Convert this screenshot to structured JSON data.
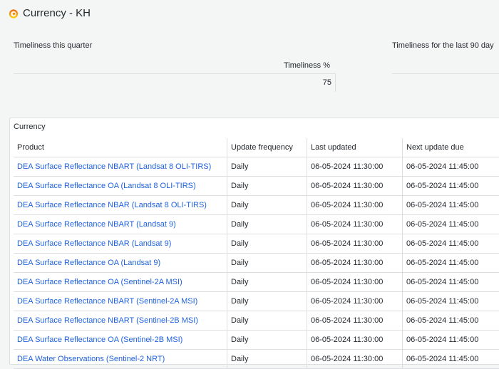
{
  "header": {
    "title": "Currency - KH",
    "logo_icon": "grafana-logo-icon"
  },
  "panel_quarter": {
    "title": "Timeliness this quarter",
    "column_header": "Timeliness %",
    "value": "75"
  },
  "panel_90days": {
    "title": "Timeliness for the last 90 day"
  },
  "currency": {
    "title": "Currency",
    "columns": [
      "Product",
      "Update frequency",
      "Last updated",
      "Next update due"
    ],
    "rows": [
      {
        "product": "DEA Surface Reflectance NBART (Landsat 8 OLI-TIRS)",
        "frequency": "Daily",
        "last": "06-05-2024 11:30:00",
        "next": "06-05-2024 11:45:00"
      },
      {
        "product": "DEA Surface Reflectance OA (Landsat 8 OLI-TIRS)",
        "frequency": "Daily",
        "last": "06-05-2024 11:30:00",
        "next": "06-05-2024 11:45:00"
      },
      {
        "product": "DEA Surface Reflectance NBAR (Landsat 8 OLI-TIRS)",
        "frequency": "Daily",
        "last": "06-05-2024 11:30:00",
        "next": "06-05-2024 11:45:00"
      },
      {
        "product": "DEA Surface Reflectance NBART (Landsat 9)",
        "frequency": "Daily",
        "last": "06-05-2024 11:30:00",
        "next": "06-05-2024 11:45:00"
      },
      {
        "product": "DEA Surface Reflectance NBAR (Landsat 9)",
        "frequency": "Daily",
        "last": "06-05-2024 11:30:00",
        "next": "06-05-2024 11:45:00"
      },
      {
        "product": "DEA Surface Reflectance OA (Landsat 9)",
        "frequency": "Daily",
        "last": "06-05-2024 11:30:00",
        "next": "06-05-2024 11:45:00"
      },
      {
        "product": "DEA Surface Reflectance OA (Sentinel-2A MSI)",
        "frequency": "Daily",
        "last": "06-05-2024 11:30:00",
        "next": "06-05-2024 11:45:00"
      },
      {
        "product": "DEA Surface Reflectance NBART (Sentinel-2A MSI)",
        "frequency": "Daily",
        "last": "06-05-2024 11:30:00",
        "next": "06-05-2024 11:45:00"
      },
      {
        "product": "DEA Surface Reflectance NBART (Sentinel-2B MSI)",
        "frequency": "Daily",
        "last": "06-05-2024 11:30:00",
        "next": "06-05-2024 11:45:00"
      },
      {
        "product": "DEA Surface Reflectance OA (Sentinel-2B MSI)",
        "frequency": "Daily",
        "last": "06-05-2024 11:30:00",
        "next": "06-05-2024 11:45:00"
      },
      {
        "product": "DEA Water Observations (Sentinel-2 NRT)",
        "frequency": "Daily",
        "last": "06-05-2024 11:30:00",
        "next": "06-05-2024 11:45:00"
      }
    ]
  },
  "colors": {
    "link": "#1f62e0",
    "logo_orange": "#f46800",
    "logo_yellow": "#fbca0a"
  }
}
